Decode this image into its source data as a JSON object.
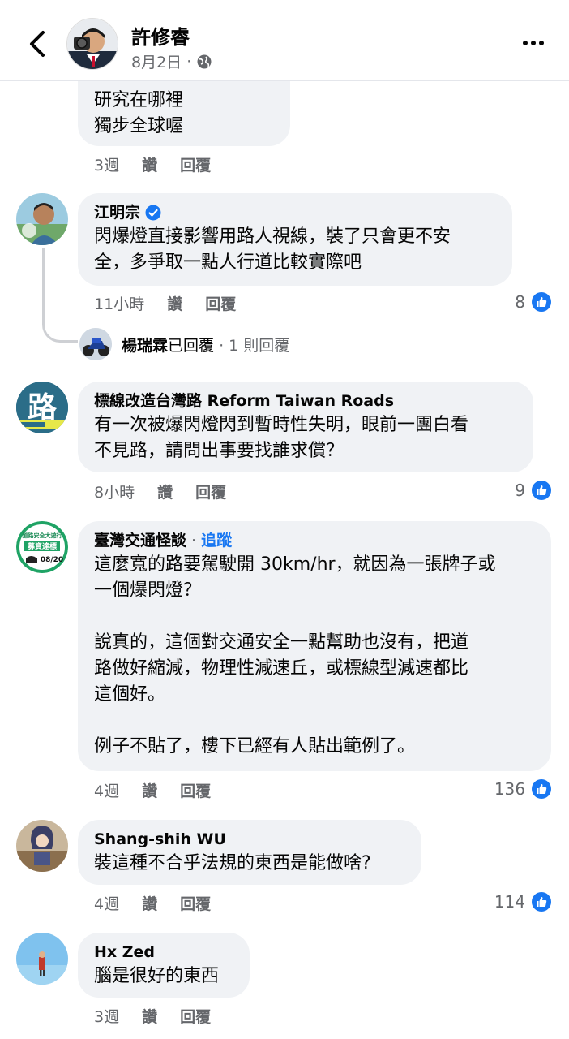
{
  "header": {
    "name": "許修睿",
    "date": "8月2日",
    "sep": "·"
  },
  "partial_comment": {
    "lines": "研究在哪裡\n獨步全球喔",
    "time": "3週",
    "like": "讚",
    "reply": "回覆"
  },
  "comments": [
    {
      "author": "江明宗",
      "verified": true,
      "text": "閃爆燈直接影響用路人視線，裝了只會更不安\n全，多爭取一點人行道比較實際吧",
      "time": "11小時",
      "like": "讚",
      "reply": "回覆",
      "reactions": "8"
    },
    {
      "author": "標線改造台灣路 Reform Taiwan Roads",
      "text": "有一次被爆閃燈閃到暫時性失明，眼前一團白看\n不見路，請問出事要找誰求償？",
      "time": "8小時",
      "like": "讚",
      "reply": "回覆",
      "reactions": "9"
    },
    {
      "author": "臺灣交通怪談",
      "follow": "追蹤",
      "sep": "·",
      "text": "這麼寬的路要駕駛開 30km/hr，就因為一張牌子或\n一個爆閃燈？\n\n說真的，這個對交通安全一點幫助也沒有，把道\n路做好縮減，物理性減速丘，或標線型減速都比\n這個好。\n\n例子不貼了，樓下已經有人貼出範例了。",
      "time": "4週",
      "like": "讚",
      "reply": "回覆",
      "reactions": "136"
    },
    {
      "author": "Shang-shih WU",
      "text": "裝這種不合乎法規的東西是能做啥?",
      "time": "4週",
      "like": "讚",
      "reply": "回覆",
      "reactions": "114"
    },
    {
      "author": "Hx Zed",
      "text": "腦是很好的東西",
      "time": "3週",
      "like": "讚",
      "reply": "回覆"
    }
  ],
  "reply_thread": {
    "name": "楊瑞霖",
    "action": "已回覆",
    "count": "· 1 則回覆"
  },
  "avatar_texts": {
    "roads": "路",
    "taiwan_traffic_1": "道路安全大遊行",
    "taiwan_traffic_2": "募資達標",
    "taiwan_traffic_3": "08/20"
  },
  "colors": {
    "accent": "#1877f2",
    "bubble": "#f0f2f5",
    "meta": "#65676b"
  }
}
